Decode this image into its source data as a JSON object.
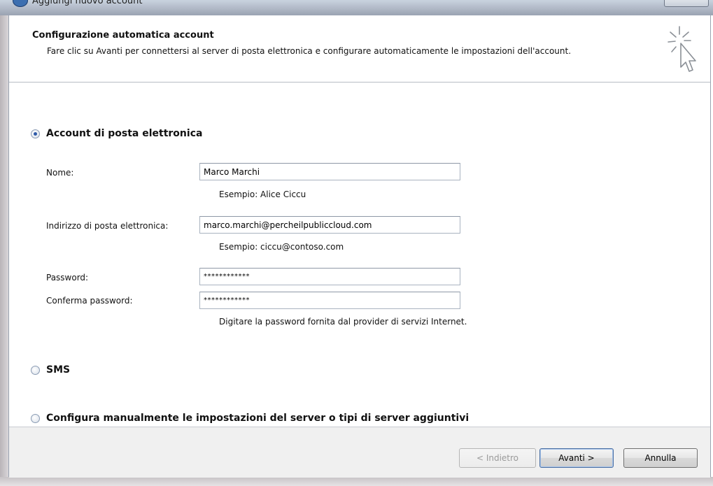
{
  "window": {
    "title": "Aggiungi nuovo account"
  },
  "header": {
    "title": "Configurazione automatica account",
    "description": "Fare clic su Avanti per connettersi al server di posta elettronica e configurare automaticamente le impostazioni dell'account.",
    "icon": "cursor-sparkle-icon"
  },
  "options": {
    "email_account": {
      "label": "Account di posta elettronica",
      "selected": true
    },
    "sms": {
      "label": "SMS",
      "selected": false
    },
    "manual": {
      "label": "Configura manualmente le impostazioni del server o tipi di server aggiuntivi",
      "selected": false
    }
  },
  "form": {
    "name": {
      "label": "Nome:",
      "value": "Marco Marchi",
      "hint": "Esempio: Alice Ciccu"
    },
    "email": {
      "label": "Indirizzo di posta elettronica:",
      "value": "marco.marchi@percheilpubliccloud.com",
      "hint": "Esempio: ciccu@contoso.com"
    },
    "password": {
      "label": "Password:",
      "value": "************"
    },
    "confirm_password": {
      "label": "Conferma password:",
      "value": "************"
    },
    "password_hint": "Digitare la password fornita dal provider di servizi Internet."
  },
  "buttons": {
    "back": "< Indietro",
    "next": "Avanti >",
    "cancel": "Annulla"
  }
}
